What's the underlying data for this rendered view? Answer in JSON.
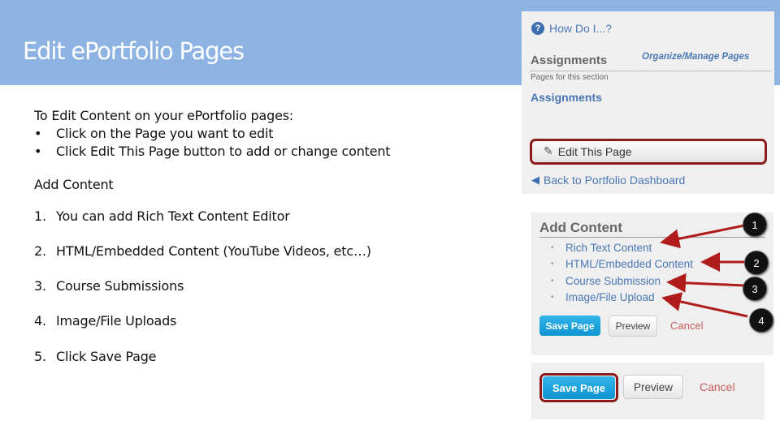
{
  "slide": {
    "title": "Edit ePortfolio Pages",
    "intro_heading": "To Edit Content on your ePortfolio pages:",
    "bullets": [
      {
        "marker": "•",
        "text": "Click on the Page you want to edit"
      },
      {
        "marker": "•",
        "text": "Click Edit This Page button to add or change content"
      }
    ],
    "add_content_heading": "Add Content",
    "steps": [
      {
        "num": "1.",
        "text": "You can add Rich Text Content Editor"
      },
      {
        "num": "2.",
        "text": "HTML/Embedded Content (YouTube Videos, etc…)"
      },
      {
        "num": "3.",
        "text": "Course Submissions"
      },
      {
        "num": "4.",
        "text": "Image/File Uploads"
      },
      {
        "num": "5.",
        "text": "Click Save Page"
      }
    ]
  },
  "panel_sidebar": {
    "help_icon": "question-circle-icon",
    "help_glyph": "?",
    "help_link": "How Do I...?",
    "section_title": "Assignments",
    "organize_link": "Organize/Manage Pages",
    "pages_caption": "Pages for this section",
    "page_link": "Assignments",
    "edit_button": "Edit This Page",
    "edit_icon": "pencil-icon",
    "edit_glyph": "✎",
    "back_icon": "arrow-left-icon",
    "back_glyph": "◀",
    "back_link": "Back to Portfolio Dashboard"
  },
  "panel_add_content": {
    "heading": "Add Content",
    "items": [
      "Rich Text Content",
      "HTML/Embedded Content",
      "Course Submission",
      "Image/File Upload"
    ],
    "bullet": "•",
    "save_button": "Save Page",
    "preview_button": "Preview",
    "cancel_link": "Cancel",
    "callouts": [
      "1",
      "2",
      "3",
      "4"
    ]
  },
  "panel_save": {
    "save_button": "Save Page",
    "preview_button": "Preview",
    "cancel_link": "Cancel"
  },
  "colors": {
    "header_band": "#8db3e2",
    "link_blue": "#4a77b4",
    "highlight_red": "#8b1a1a",
    "save_blue": "#1ca4df",
    "cancel_red": "#cd5c5c"
  }
}
